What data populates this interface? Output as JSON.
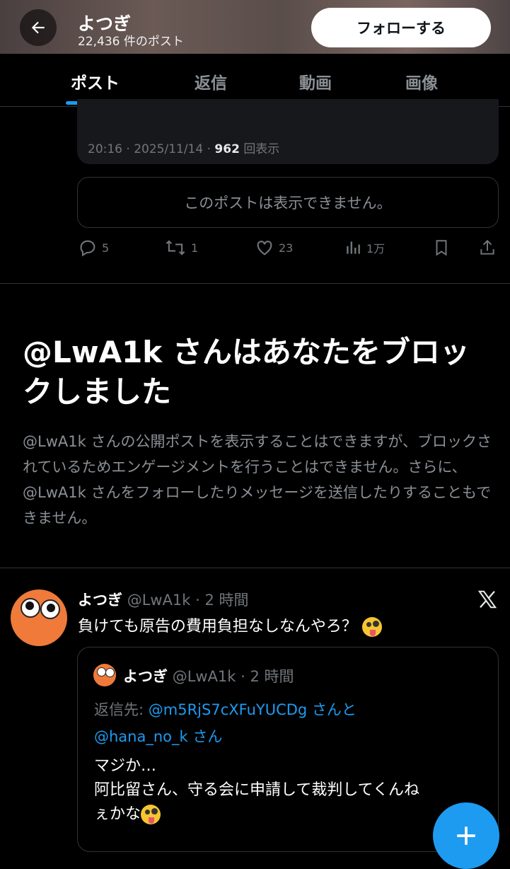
{
  "header": {
    "name": "よつぎ",
    "post_count": "22,436 件のポスト",
    "follow_label": "フォローする"
  },
  "tabs": [
    {
      "label": "ポスト",
      "active": true
    },
    {
      "label": "返信",
      "active": false
    },
    {
      "label": "動画",
      "active": false
    },
    {
      "label": "画像",
      "active": false
    }
  ],
  "previous_post": {
    "time_date": "20:16 · 2025/11/14 · ",
    "views": "962",
    "views_suffix": "回表示",
    "unavailable": "このポストは表示できません。",
    "actions": {
      "replies": "5",
      "reposts": "1",
      "likes": "23",
      "views": "1万"
    }
  },
  "block_notice": {
    "title": "@LwA1k さんはあなたをブロックしました",
    "description": "@LwA1k さんの公開ポストを表示することはできますが、ブロックされているためエンゲージメントを行うことはできません。さらに、@LwA1k さんをフォローしたりメッセージを送信したりすることもできません。"
  },
  "tweet": {
    "name": "よつぎ",
    "meta": "@LwA1k · 2 時間",
    "text": "負けても原告の費用負担なしなんやろ？",
    "quoted": {
      "name": "よつぎ",
      "meta": "@LwA1k · 2 時間",
      "reply_prefix": "返信先: ",
      "mention1": "@m5RjS7cXFuYUCDg",
      "mention1_suffix": " さんと",
      "mention2": "@hana_no_k",
      "mention2_suffix": " さん",
      "line1": "マジか…",
      "line2": "阿比留さん、守る会に申請して裁判してくんね",
      "line3": "ぇかな"
    }
  },
  "colors": {
    "accent": "#1d9bf0",
    "background": "#000000",
    "muted": "#71767b",
    "avatar": "#f07a3a"
  },
  "icons": [
    "back-arrow-icon",
    "reply-icon",
    "repost-icon",
    "like-icon",
    "views-icon",
    "bookmark-icon",
    "share-icon",
    "x-logo-icon",
    "plus-icon",
    "zany-face-emoji"
  ]
}
